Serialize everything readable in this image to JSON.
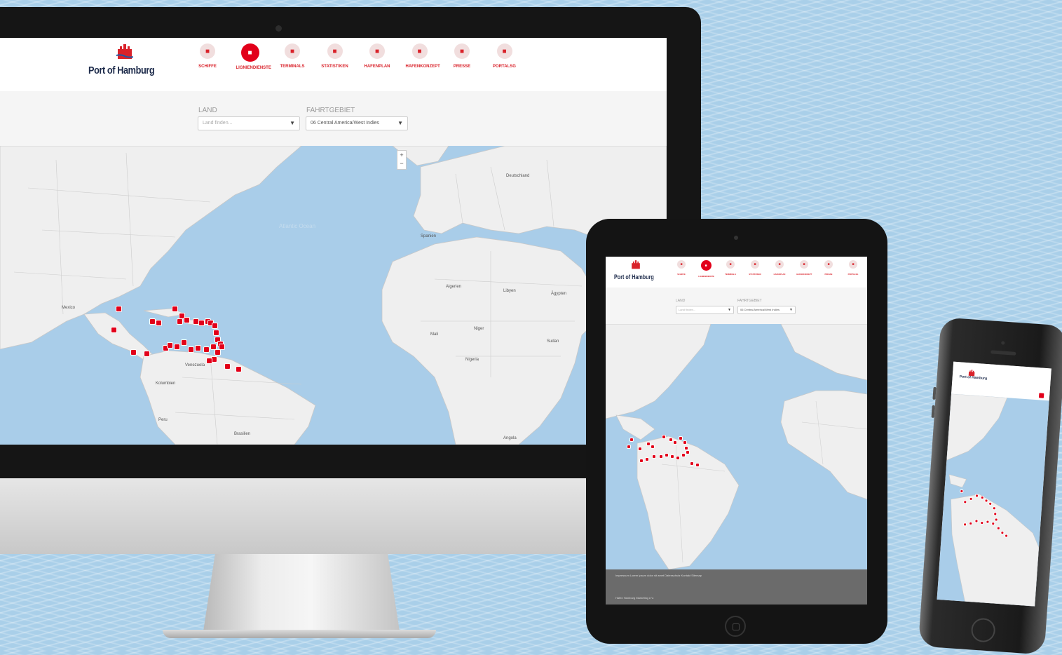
{
  "brand": {
    "logo_text": "Port of Hamburg",
    "accent_color": "#e2001a",
    "ocean_color": "#a9cde9"
  },
  "desktop": {
    "nav": [
      {
        "label": "SCHIFFE",
        "icon": "ship-icon",
        "active": false
      },
      {
        "label": "LIGNIENDIENSTE",
        "icon": "globe-icon",
        "active": true
      },
      {
        "label": "TERMINALS",
        "icon": "crane-icon",
        "active": false
      },
      {
        "label": "STATISTIKEN",
        "icon": "chart-icon",
        "active": false
      },
      {
        "label": "HAFENPLAN",
        "icon": "map-icon",
        "active": false
      },
      {
        "label": "HAFENKONZEPT",
        "icon": "shield-icon",
        "active": false
      },
      {
        "label": "PRESSE",
        "icon": "newspaper-icon",
        "active": false
      },
      {
        "label": "PORTALSG",
        "icon": "boat-icon",
        "active": false
      }
    ],
    "filters": {
      "land_label": "LAND",
      "land_value": "Land finden...",
      "fahrtgebiet_label": "FAHRTGEBIET",
      "fahrtgebiet_value": "06 Central America/West Indies"
    },
    "map_labels": {
      "atlantic": "Atlantic Ocean",
      "mexico": "Mexico",
      "venezuela": "Venezuela",
      "colombia": "Kolumbien",
      "peru": "Peru",
      "brazil": "Brasilien",
      "algeria": "Algerien",
      "libya": "Libyen",
      "egypt": "Ägypten",
      "mali": "Mali",
      "niger": "Niger",
      "nigeria": "Nigeria",
      "sudan": "Sudan",
      "germany": "Deutschland",
      "spain": "Spanien",
      "angola": "Angola"
    },
    "zoom_in": "+",
    "zoom_out": "−"
  },
  "tablet": {
    "footer_rows": [
      "Impressum    Lorem ipsum dolor sit amet    Datenschutz    Kontakt    Sitemap",
      "Hafen Hamburg Marketing e.V."
    ]
  },
  "icons": {
    "select_caret": "chevron-down-icon"
  }
}
